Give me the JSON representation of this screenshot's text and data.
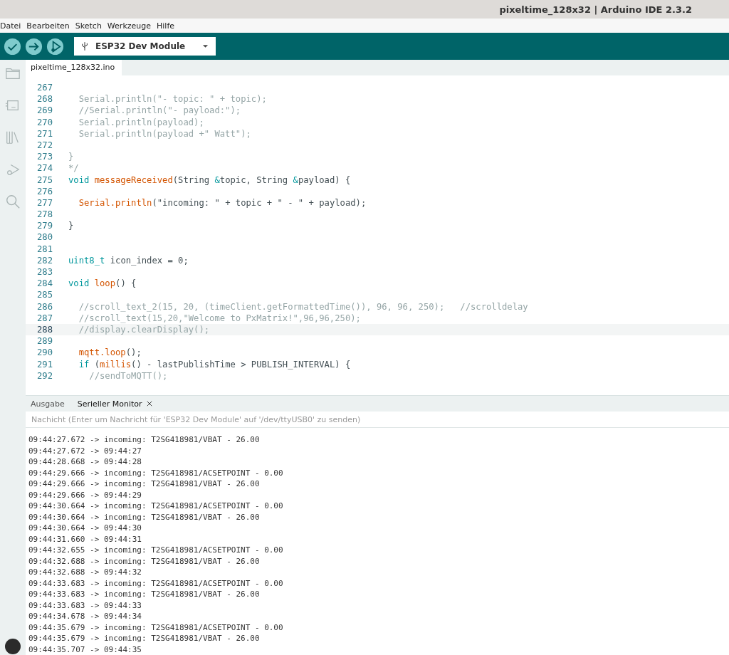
{
  "window": {
    "title": "pixeltime_128x32 | Arduino IDE 2.3.2"
  },
  "menu": [
    "Datei",
    "Bearbeiten",
    "Sketch",
    "Werkzeuge",
    "Hilfe"
  ],
  "board": {
    "label": "ESP32 Dev Module"
  },
  "file_tab": {
    "label": "pixeltime_128x32.ino"
  },
  "sidebar": {
    "items": [
      {
        "kind": "folder",
        "selected": false
      },
      {
        "kind": "board",
        "selected": false
      },
      {
        "kind": "library",
        "selected": false
      },
      {
        "kind": "debug",
        "selected": false
      },
      {
        "kind": "search",
        "selected": false
      }
    ]
  },
  "editor": {
    "lines": [
      {
        "number": "267",
        "current": false
      },
      {
        "number": "268",
        "current": false,
        "tokens": [
          {
            "kind": "comment",
            "text": "  Serial.println(\"- topic: \" + topic);"
          }
        ]
      },
      {
        "number": "269",
        "current": false,
        "tokens": [
          {
            "kind": "comment",
            "text": "  //Serial.println(\"- payload:\");"
          }
        ]
      },
      {
        "number": "270",
        "current": false,
        "tokens": [
          {
            "kind": "comment",
            "text": "  Serial.println(payload);"
          }
        ]
      },
      {
        "number": "271",
        "current": false,
        "tokens": [
          {
            "kind": "comment",
            "text": "  Serial.println(payload +\" Watt\");"
          }
        ]
      },
      {
        "number": "272",
        "current": false
      },
      {
        "number": "273",
        "current": false,
        "tokens": [
          {
            "kind": "comment",
            "text": "}"
          }
        ]
      },
      {
        "number": "274",
        "current": false,
        "tokens": [
          {
            "kind": "comment",
            "text": "*/"
          }
        ]
      },
      {
        "number": "275",
        "current": false,
        "tokens": [
          {
            "kind": "keyword",
            "text": "void "
          },
          {
            "kind": "function",
            "text": "messageReceived"
          },
          {
            "kind": "plain",
            "text": "(String "
          },
          {
            "kind": "keyword",
            "text": "&"
          },
          {
            "kind": "plain",
            "text": "topic, String "
          },
          {
            "kind": "keyword",
            "text": "&"
          },
          {
            "kind": "plain",
            "text": "payload) {"
          }
        ]
      },
      {
        "number": "276",
        "current": false
      },
      {
        "number": "277",
        "current": false,
        "tokens": [
          {
            "kind": "function",
            "text": "  Serial.println"
          },
          {
            "kind": "plain",
            "text": "(\"incoming: \" + topic + \" - \" + payload);"
          }
        ]
      },
      {
        "number": "278",
        "current": false
      },
      {
        "number": "279",
        "current": false,
        "tokens": [
          {
            "kind": "plain",
            "text": "}"
          }
        ]
      },
      {
        "number": "280",
        "current": false
      },
      {
        "number": "281",
        "current": false
      },
      {
        "number": "282",
        "current": false,
        "tokens": [
          {
            "kind": "keyword",
            "text": "uint8_t"
          },
          {
            "kind": "plain",
            "text": " icon_index = 0;"
          }
        ]
      },
      {
        "number": "283",
        "current": false
      },
      {
        "number": "284",
        "current": false,
        "tokens": [
          {
            "kind": "keyword",
            "text": "void "
          },
          {
            "kind": "function",
            "text": "loop"
          },
          {
            "kind": "plain",
            "text": "() {"
          }
        ]
      },
      {
        "number": "285",
        "current": false
      },
      {
        "number": "286",
        "current": false,
        "tokens": [
          {
            "kind": "comment",
            "text": "  //scroll_text_2(15, 20, (timeClient.getFormattedTime()), 96, 96, 250);   //scrolldelay"
          }
        ]
      },
      {
        "number": "287",
        "current": false,
        "tokens": [
          {
            "kind": "comment",
            "text": "  //scroll_text(15,20,\"Welcome to PxMatrix!\",96,96,250);"
          }
        ]
      },
      {
        "number": "288",
        "current": true,
        "tokens": [
          {
            "kind": "comment",
            "text": "  //display.clearDisplay();"
          }
        ]
      },
      {
        "number": "289",
        "current": false
      },
      {
        "number": "290",
        "current": false,
        "tokens": [
          {
            "kind": "function",
            "text": "  mqtt.loop"
          },
          {
            "kind": "plain",
            "text": "();"
          }
        ]
      },
      {
        "number": "291",
        "current": false,
        "tokens": [
          {
            "kind": "keyword",
            "text": "  if"
          },
          {
            "kind": "plain",
            "text": " ("
          },
          {
            "kind": "function",
            "text": "millis"
          },
          {
            "kind": "plain",
            "text": "() - lastPublishTime > PUBLISH_INTERVAL) {"
          }
        ]
      },
      {
        "number": "292",
        "current": false,
        "tokens": [
          {
            "kind": "comment",
            "text": "    //sendToMQTT();"
          }
        ]
      }
    ]
  },
  "panel": {
    "tabs": [
      {
        "label": "Ausgabe",
        "selected": false,
        "closable": false
      },
      {
        "label": "Serieller Monitor",
        "selected": true,
        "closable": true
      }
    ],
    "input": {
      "placeholder": "Nachicht (Enter um Nachricht für 'ESP32 Dev Module' auf '/dev/ttyUSB0' zu senden)"
    },
    "output": [
      "09:44:27.672 -> incoming: T2SG418981/VBAT - 26.00",
      "09:44:27.672 -> 09:44:27",
      "09:44:28.668 -> 09:44:28",
      "09:44:29.666 -> incoming: T2SG418981/ACSETPOINT - 0.00",
      "09:44:29.666 -> incoming: T2SG418981/VBAT - 26.00",
      "09:44:29.666 -> 09:44:29",
      "09:44:30.664 -> incoming: T2SG418981/ACSETPOINT - 0.00",
      "09:44:30.664 -> incoming: T2SG418981/VBAT - 26.00",
      "09:44:30.664 -> 09:44:30",
      "09:44:31.660 -> 09:44:31",
      "09:44:32.655 -> incoming: T2SG418981/ACSETPOINT - 0.00",
      "09:44:32.688 -> incoming: T2SG418981/VBAT - 26.00",
      "09:44:32.688 -> 09:44:32",
      "09:44:33.683 -> incoming: T2SG418981/ACSETPOINT - 0.00",
      "09:44:33.683 -> incoming: T2SG418981/VBAT - 26.00",
      "09:44:33.683 -> 09:44:33",
      "09:44:34.678 -> 09:44:34",
      "09:44:35.679 -> incoming: T2SG418981/ACSETPOINT - 0.00",
      "09:44:35.679 -> incoming: T2SG418981/VBAT - 26.00",
      "09:44:35.707 -> 09:44:35"
    ]
  }
}
